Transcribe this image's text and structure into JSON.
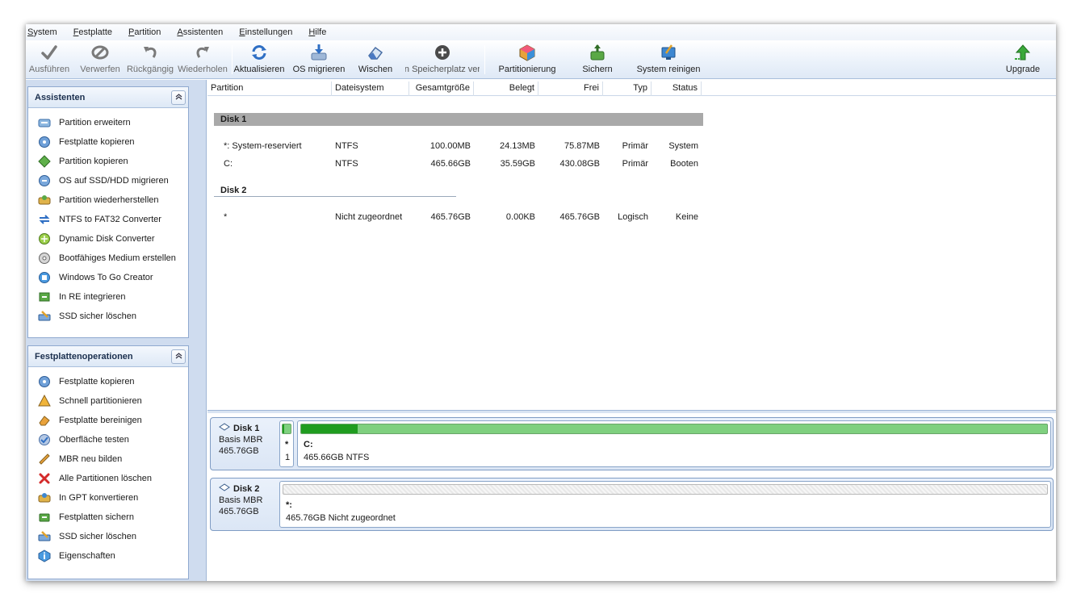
{
  "menu": [
    {
      "label": "System",
      "u": "S",
      "rest": "ystem"
    },
    {
      "label": "Festplatte",
      "u": "F",
      "rest": "estplatte"
    },
    {
      "label": "Partition",
      "u": "P",
      "rest": "artition"
    },
    {
      "label": "Assistenten",
      "u": "A",
      "rest": "ssistenten"
    },
    {
      "label": "Einstellungen",
      "u": "E",
      "rest": "instellungen"
    },
    {
      "label": "Hilfe",
      "u": "H",
      "rest": "ilfe"
    }
  ],
  "toolbar": {
    "apply": "Ausführen",
    "discard": "Verwerfen",
    "undo": "Rückgängig",
    "redo": "Wiederholen",
    "refresh": "Aktualisieren",
    "migrate_os": "OS migrieren",
    "wipe": "Wischen",
    "space": "n Speicherplatz ver",
    "partitioning": "Partitionierung",
    "backup": "Sichern",
    "cleanup": "System reinigen",
    "upgrade": "Upgrade"
  },
  "wizards": {
    "title": "Assistenten",
    "items": [
      "Partition erweitern",
      "Festplatte kopieren",
      "Partition kopieren",
      "OS auf SSD/HDD migrieren",
      "Partition wiederherstellen",
      "NTFS to FAT32 Converter",
      "Dynamic Disk Converter",
      "Bootfähiges Medium erstellen",
      "Windows To Go Creator",
      "In RE integrieren",
      "SSD sicher löschen"
    ]
  },
  "disk_ops": {
    "title": "Festplattenoperationen",
    "items": [
      "Festplatte kopieren",
      "Schnell partitionieren",
      "Festplatte bereinigen",
      "Oberfläche testen",
      "MBR neu bilden",
      "Alle Partitionen löschen",
      "In GPT konvertieren",
      "Festplatten sichern",
      "SSD sicher löschen",
      "Eigenschaften"
    ]
  },
  "columns": {
    "partition": "Partition",
    "filesystem": "Dateisystem",
    "total": "Gesamtgröße",
    "used": "Belegt",
    "free": "Frei",
    "type": "Typ",
    "status": "Status"
  },
  "list": {
    "disk1_label": "Disk 1",
    "disk2_label": "Disk 2",
    "rows": [
      {
        "partition": "*: System-reserviert",
        "fs": "NTFS",
        "total": "100.00MB",
        "used": "24.13MB",
        "free": "75.87MB",
        "type": "Primär",
        "status": "System"
      },
      {
        "partition": "C:",
        "fs": "NTFS",
        "total": "465.66GB",
        "used": "35.59GB",
        "free": "430.08GB",
        "type": "Primär",
        "status": "Booten"
      },
      {
        "partition": "*",
        "fs": "Nicht zugeordnet",
        "total": "465.76GB",
        "used": "0.00KB",
        "free": "465.76GB",
        "type": "Logisch",
        "status": "Keine"
      }
    ]
  },
  "diskmap": {
    "disk1": {
      "name": "Disk 1",
      "kind": "Basis MBR",
      "size": "465.76GB",
      "small_part": {
        "label": "*",
        "num": "1"
      },
      "main_part": {
        "label": "C:",
        "desc": "465.66GB NTFS",
        "used_fraction": 0.076
      }
    },
    "disk2": {
      "name": "Disk 2",
      "kind": "Basis MBR",
      "size": "465.76GB",
      "main_part": {
        "label": "*:",
        "desc": "465.76GB Nicht zugeordnet",
        "used_fraction": 0
      }
    }
  }
}
